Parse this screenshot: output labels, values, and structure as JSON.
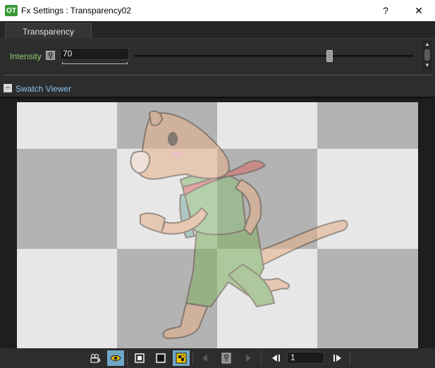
{
  "window": {
    "app_icon_text": "OT",
    "title": "Fx Settings : Transparency02",
    "help_label": "?",
    "close_label": "✕"
  },
  "tabs": [
    {
      "label": "Transparency",
      "selected": true
    }
  ],
  "params": {
    "intensity_label": "Intensity",
    "intensity_value": "70",
    "intensity_slider_fraction": 0.7,
    "key_icon": "key-icon"
  },
  "swatch": {
    "collapse_symbol": "−",
    "label": "Swatch Viewer"
  },
  "toolbar": {
    "frame_value": "1",
    "icons": [
      "camera-icon",
      "eye-icon",
      "white-bg-icon",
      "black-bg-icon",
      "checker-bg-icon",
      "prev-key-icon",
      "key-icon",
      "next-key-icon",
      "prev-frame-icon",
      "next-frame-icon"
    ]
  },
  "colors": {
    "accent_label": "#8fd06a",
    "link_label": "#8fc3ea",
    "active_tool": "#6fa7c6",
    "highlight_tool": "#f0c400"
  }
}
